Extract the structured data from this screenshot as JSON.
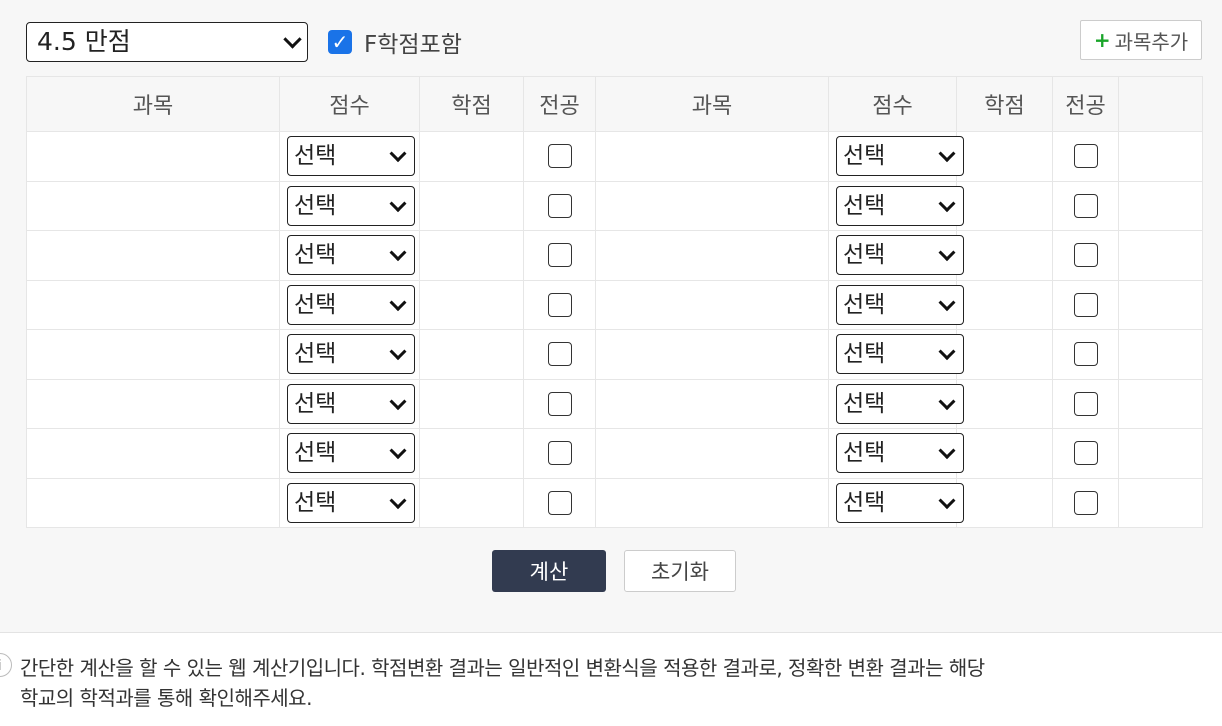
{
  "toolbar": {
    "scale_value": "4.5 만점",
    "include_f_label": "F학점포함",
    "include_f_checked": true,
    "add_subject_label": "과목추가"
  },
  "table": {
    "headers": [
      "과목",
      "점수",
      "학점",
      "전공",
      "과목",
      "점수",
      "학점",
      "전공"
    ],
    "grade_placeholder": "선택",
    "row_count": 8
  },
  "actions": {
    "calculate_label": "계산",
    "reset_label": "초기화"
  },
  "footer": {
    "note_line1": "간단한 계산을 할 수 있는 웹 계산기입니다. 학점변환 결과는 일반적인 변환식을 적용한 결과로, 정확한 변환 결과는 해당",
    "note_line2": "학교의 학적과를 통해 확인해주세요."
  }
}
